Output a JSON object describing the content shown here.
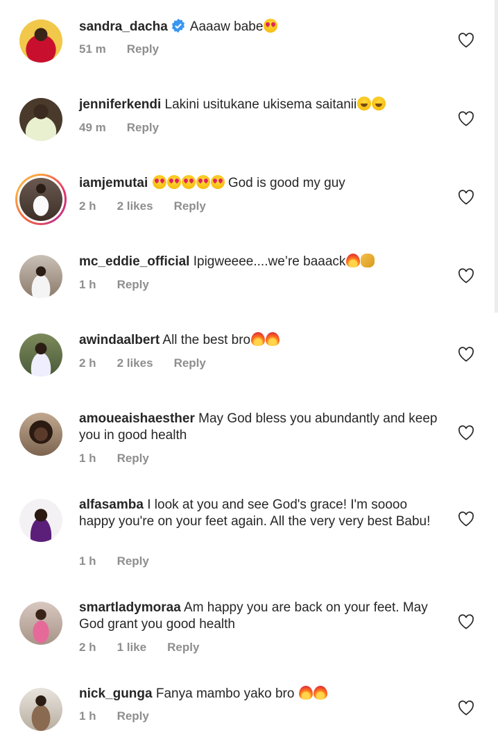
{
  "comments": [
    {
      "username": "sandra_dacha",
      "verified": true,
      "text": "Aaaaw babe",
      "emojis": [
        "love"
      ],
      "time": "51 m",
      "likes": "",
      "reply": "Reply"
    },
    {
      "username": "jenniferkendi",
      "verified": false,
      "text": "Lakini usitukane ukisema saitanii",
      "emojis": [
        "laugh",
        "laugh"
      ],
      "time": "49 m",
      "likes": "",
      "reply": "Reply"
    },
    {
      "username": "iamjemutai",
      "verified": false,
      "text_before_emojis": "",
      "emojis_lead": [
        "love",
        "love",
        "love",
        "love",
        "love"
      ],
      "text": "God is good my guy",
      "time": "2 h",
      "likes": "2 likes",
      "reply": "Reply"
    },
    {
      "username": "mc_eddie_official",
      "verified": false,
      "text": "Ipigweeee....we’re baaack",
      "emojis": [
        "fire",
        "clap"
      ],
      "time": "1 h",
      "likes": "",
      "reply": "Reply"
    },
    {
      "username": "awindaalbert",
      "verified": false,
      "text": "All the best bro",
      "emojis": [
        "fire",
        "fire"
      ],
      "time": "2 h",
      "likes": "2 likes",
      "reply": "Reply"
    },
    {
      "username": "amoueaishaesther",
      "verified": false,
      "text": "May God bless you abundantly and keep you in good health",
      "emojis": [],
      "time": "1 h",
      "likes": "",
      "reply": "Reply"
    },
    {
      "username": "alfasamba",
      "verified": false,
      "text": "I look at you and see God's grace! I'm soooo happy you're on your feet again. All the very very best Babu!",
      "emojis": [],
      "time": "1 h",
      "likes": "",
      "reply": "Reply"
    },
    {
      "username": "smartladymoraa",
      "verified": false,
      "text": "Am happy you are back on your feet. May God grant you good health",
      "emojis": [],
      "time": "2 h",
      "likes": "1 like",
      "reply": "Reply"
    },
    {
      "username": "nick_gunga",
      "verified": false,
      "text": "Fanya mambo yako bro",
      "emojis": [
        "fire",
        "fire"
      ],
      "time": "1 h",
      "likes": "",
      "reply": "Reply"
    }
  ],
  "icons": {
    "like": "heart-outline-icon",
    "verified": "verified-badge-icon"
  },
  "colors": {
    "text": "#262626",
    "meta": "#8e8e8e",
    "verified": "#3897f0"
  }
}
